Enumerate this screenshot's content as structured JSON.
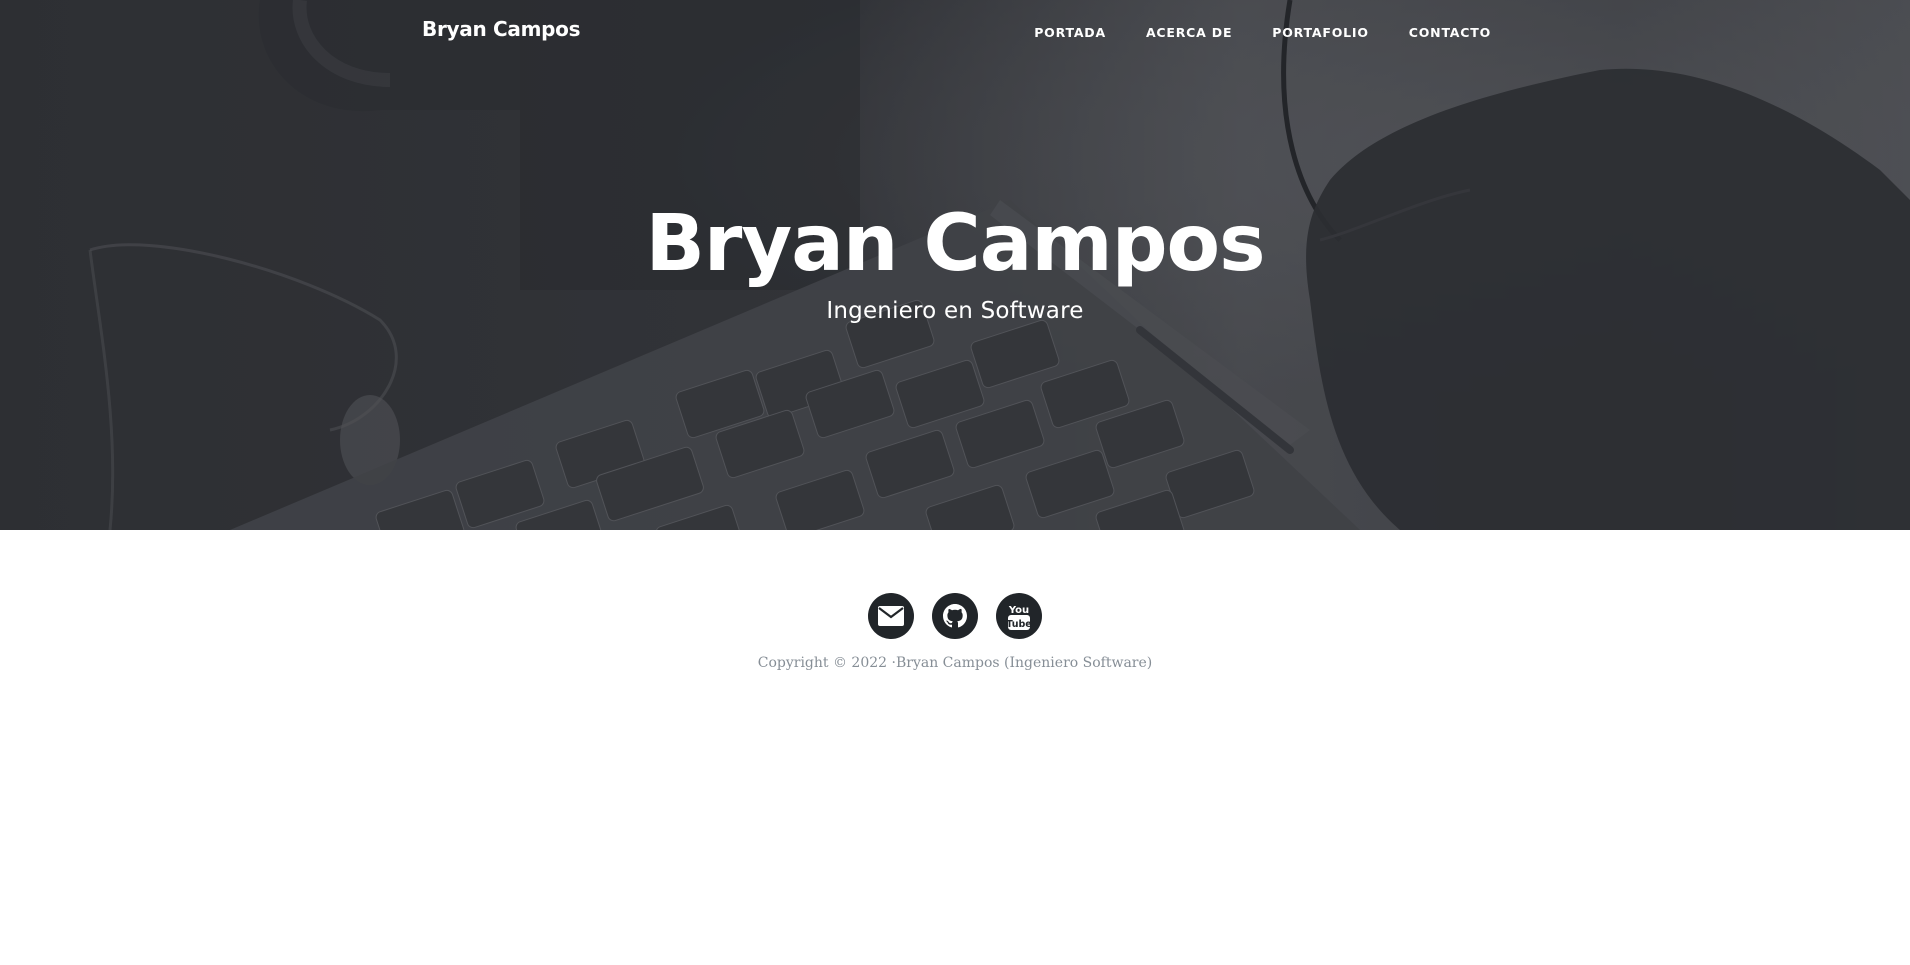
{
  "navbar": {
    "brand": "Bryan Campos",
    "links": [
      {
        "label": "PORTADA"
      },
      {
        "label": "ACERCA DE"
      },
      {
        "label": "PORTAFOLIO"
      },
      {
        "label": "CONTACTO"
      }
    ]
  },
  "hero": {
    "title": "Bryan Campos",
    "subtitle": "Ingeniero en Software"
  },
  "footer": {
    "social": [
      {
        "icon": "envelope-icon"
      },
      {
        "icon": "github-icon"
      },
      {
        "icon": "youtube-icon",
        "badge_top": "You",
        "badge_bottom": "Tube"
      }
    ],
    "copyright": "Copyright © 2022 ·Bryan Campos (Ingeniero Software)"
  },
  "colors": {
    "hero_overlay": "#3d3e43",
    "icon_circle": "#212529",
    "copyright_text": "#868e96",
    "white": "#ffffff"
  }
}
